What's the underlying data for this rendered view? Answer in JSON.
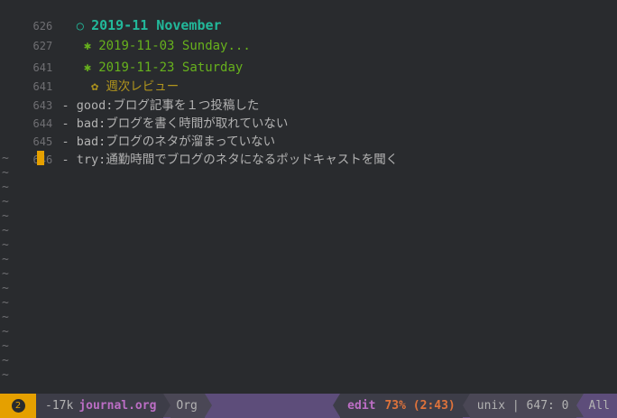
{
  "editor": {
    "lines": [
      {
        "num": "626",
        "bullet": "○",
        "text": "2019-11 November"
      },
      {
        "num": "627",
        "bullet": "✱",
        "text": "2019-11-03 Sunday..."
      },
      {
        "num": "641",
        "bullet": "✱",
        "text": "2019-11-23 Saturday"
      },
      {
        "num": "641",
        "bullet": "✿",
        "text": "週次レビュー"
      },
      {
        "num": "643",
        "dash": "-",
        "key": "good:",
        "text": "ブログ記事を１つ投稿した"
      },
      {
        "num": "644",
        "dash": "-",
        "key": "bad:",
        "text": "ブログを書く時間が取れていない"
      },
      {
        "num": "645",
        "dash": "-",
        "key": "bad:",
        "text": "ブログのネタが溜まっていない"
      },
      {
        "num": "646",
        "dash": "-",
        "key": "try:",
        "text": "通勤時間でブログのネタになるポッドキャストを聞く"
      }
    ],
    "empty_marker": "~"
  },
  "modeline": {
    "state_number": "2",
    "modified_flag": "-",
    "size": "17k",
    "filename": "journal.org",
    "major_mode": "Org",
    "vc_state": "edit",
    "position": "73% (2:43)",
    "encoding": "unix | 647: 0",
    "scroll": "All"
  },
  "colors": {
    "background": "#292b2e",
    "heading1": "#22b89a",
    "heading2": "#67b11d",
    "heading3": "#b1951d",
    "cursor": "#e5a000",
    "modeline": "#5d4d7a"
  }
}
